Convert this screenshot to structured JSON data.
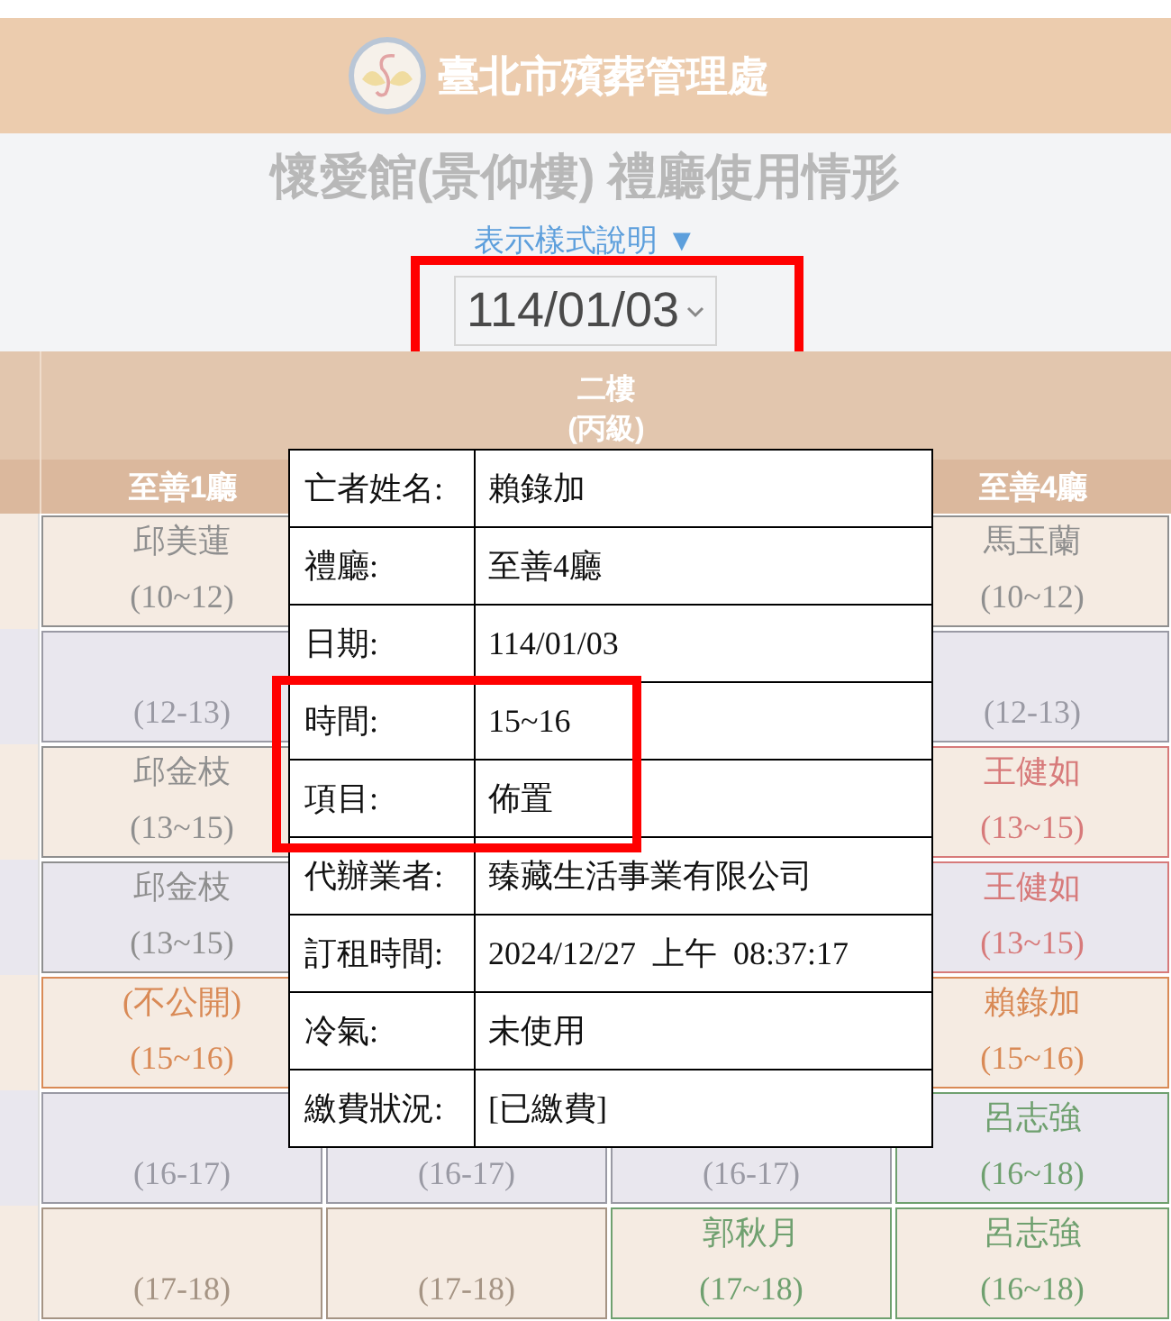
{
  "header": {
    "title": "臺北市殯葬管理處"
  },
  "page_title": "懷愛館(景仰樓) 禮廳使用情形",
  "legend_link": "表示樣式說明 ▼",
  "date_select": {
    "value": "114/01/03",
    "highlighted": true
  },
  "table": {
    "floor": "二樓",
    "grade": "(丙級)",
    "columns": [
      {
        "label": "至善1廳"
      },
      {},
      {},
      {
        "label": "至善4廳"
      }
    ],
    "rows": [
      {
        "cells": [
          {
            "kind": "slot",
            "name": "邱美蓮",
            "time": "(10~12)",
            "color": "#8f8f8f"
          },
          {
            "kind": "covered"
          },
          {
            "kind": "covered"
          },
          {
            "kind": "slot",
            "name": "馬玉蘭",
            "time": "(10~12)",
            "color": "#8f8f8f"
          }
        ]
      },
      {
        "cells": [
          {
            "kind": "slot",
            "time": "(12-13)",
            "color": "#9a9aa4"
          },
          {
            "kind": "covered"
          },
          {
            "kind": "covered"
          },
          {
            "kind": "slot",
            "time": "(12-13)",
            "color": "#9a9aa4"
          }
        ]
      },
      {
        "cells": [
          {
            "kind": "slot",
            "name": "邱金枝",
            "time": "(13~15)",
            "color": "#8f8f8f"
          },
          {
            "kind": "covered"
          },
          {
            "kind": "covered"
          },
          {
            "kind": "slot",
            "name": "王健如",
            "time": "(13~15)",
            "color": "#d77a7a"
          }
        ]
      },
      {
        "cells": [
          {
            "kind": "slot",
            "name": "邱金枝",
            "time": "(13~15)",
            "color": "#8f8f8f"
          },
          {
            "kind": "covered"
          },
          {
            "kind": "covered"
          },
          {
            "kind": "slot",
            "name": "王健如",
            "time": "(13~15)",
            "color": "#d77a7a"
          }
        ]
      },
      {
        "cells": [
          {
            "kind": "slot",
            "name": "(不公開)",
            "time": "(15~16)",
            "color": "#d98a56"
          },
          {
            "kind": "covered"
          },
          {
            "kind": "covered"
          },
          {
            "kind": "slot",
            "name": "賴錄加",
            "time": "(15~16)",
            "color": "#d98a56"
          }
        ]
      },
      {
        "cells": [
          {
            "kind": "slot",
            "time": "(16-17)",
            "color": "#9a9aa4"
          },
          {
            "kind": "slot",
            "time": "(16-17)",
            "color": "#9a9aa4"
          },
          {
            "kind": "slot",
            "time": "(16-17)",
            "color": "#9a9aa4"
          },
          {
            "kind": "slot",
            "name": "呂志強",
            "time": "(16~18)",
            "color": "#6fa06f"
          }
        ]
      },
      {
        "cells": [
          {
            "kind": "slot",
            "time": "(17-18)",
            "color": "#a59484"
          },
          {
            "kind": "slot",
            "time": "(17-18)",
            "color": "#a59484"
          },
          {
            "kind": "slot",
            "name": "郭秋月",
            "time": "(17~18)",
            "color": "#6fa06f"
          },
          {
            "kind": "slot",
            "name": "呂志強",
            "time": "(16~18)",
            "color": "#6fa06f"
          }
        ]
      }
    ]
  },
  "popup": {
    "rows": [
      {
        "label": "亡者姓名:",
        "value": "賴錄加",
        "highlighted": false
      },
      {
        "label": "禮廳:",
        "value": "至善4廳",
        "highlighted": false
      },
      {
        "label": "日期:",
        "value": "114/01/03",
        "highlighted": false
      },
      {
        "label": "時間:",
        "value": "15~16",
        "highlighted": true
      },
      {
        "label": "項目:",
        "value": "佈置",
        "highlighted": true
      },
      {
        "label": "代辦業者:",
        "value": "臻藏生活事業有限公司",
        "highlighted": false
      },
      {
        "label": "訂租時間:",
        "value": "2024/12/27  上午  08:37:17",
        "highlighted": false
      },
      {
        "label": "冷氣:",
        "value": "未使用",
        "highlighted": false
      },
      {
        "label": "繳費狀況:",
        "value": "[已繳費]",
        "highlighted": false
      }
    ]
  }
}
